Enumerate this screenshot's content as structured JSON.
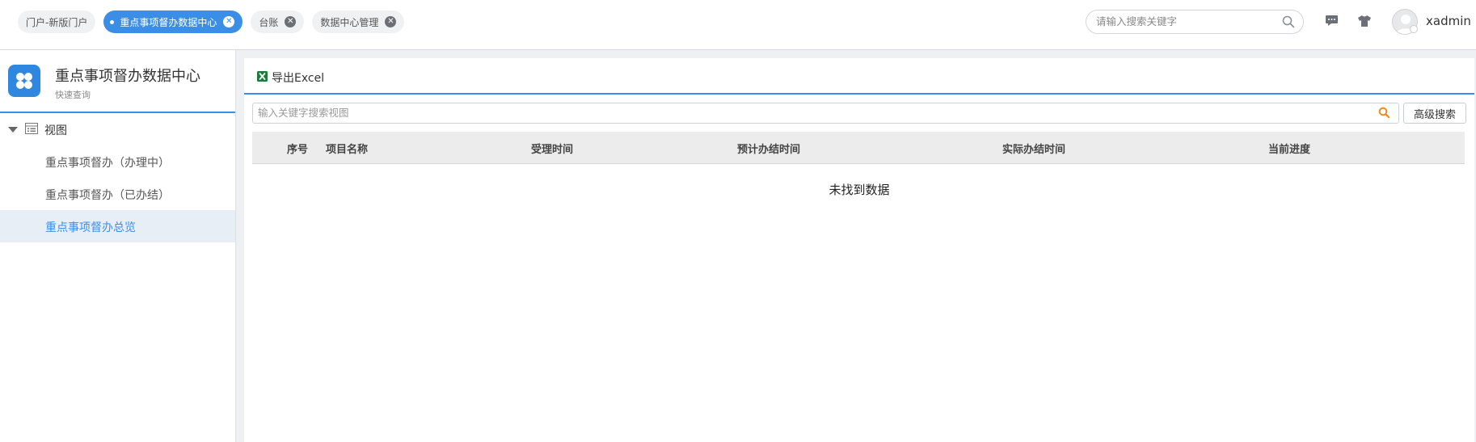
{
  "tabs": [
    {
      "label": "门户-新版门户",
      "active": false,
      "closable": false
    },
    {
      "label": "重点事项督办数据中心",
      "active": true,
      "closable": true
    },
    {
      "label": "台账",
      "active": false,
      "closable": true
    },
    {
      "label": "数据中心管理",
      "active": false,
      "closable": true
    }
  ],
  "header": {
    "search_placeholder": "请输入搜索关键字",
    "username": "xadmin",
    "icons": [
      "search-icon",
      "message-icon",
      "shirt-icon",
      "avatar"
    ]
  },
  "sidebar": {
    "title": "重点事项督办数据中心",
    "subtitle": "快速查询",
    "root_label": "视图",
    "items": [
      {
        "label": "重点事项督办（办理中）",
        "selected": false
      },
      {
        "label": "重点事项督办（已办结）",
        "selected": false
      },
      {
        "label": "重点事项督办总览",
        "selected": true
      }
    ]
  },
  "main": {
    "export_label": "导出Excel",
    "filter_placeholder": "输入关键字搜索视图",
    "advanced_search_label": "高级搜索",
    "columns": [
      "序号",
      "项目名称",
      "受理时间",
      "预计办结时间",
      "实际办结时间",
      "当前进度"
    ],
    "empty_text": "未找到数据"
  },
  "colors": {
    "accent": "#3b8ee6",
    "excel_green": "#1f7a3e",
    "search_orange": "#f08a24"
  }
}
